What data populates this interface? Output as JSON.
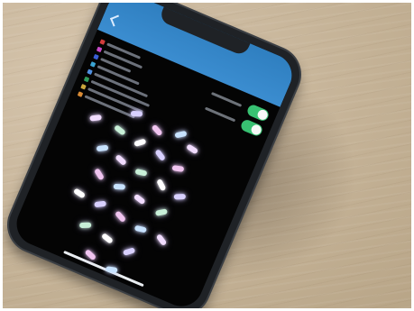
{
  "scene": {
    "subject": "smartphone-on-wooden-table",
    "colors": {
      "header": "#3b8dd0",
      "screen": "#040404",
      "table": "#c9b79c",
      "toggle_on": "#38c172"
    }
  },
  "app": {
    "status_time": "",
    "title": "",
    "legend": [
      {
        "color": "#d23c3c",
        "label": ""
      },
      {
        "color": "#c84ac8",
        "label": ""
      },
      {
        "color": "#3a5ed6",
        "label": ""
      },
      {
        "color": "#3aa3d2",
        "label": ""
      },
      {
        "color": "#4f8fe0",
        "label": ""
      },
      {
        "color": "#2f9a5a",
        "label": ""
      },
      {
        "color": "#c9a53c",
        "label": ""
      },
      {
        "color": "#d98b35",
        "label": ""
      }
    ],
    "toggles": [
      {
        "label": "",
        "on": true
      },
      {
        "label": "",
        "on": true
      }
    ]
  },
  "visualization": {
    "colors": [
      "#d8d0ff",
      "#f0c4f0",
      "#c7e2ff",
      "#f1dcff",
      "#c8f0d8",
      "#ffffff"
    ]
  }
}
